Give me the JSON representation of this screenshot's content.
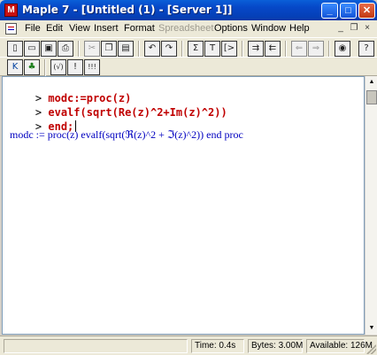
{
  "window": {
    "app_icon": "maple-leaf-icon",
    "title": "Maple 7 - [Untitled (1) - [Server 1]]",
    "buttons": {
      "minimize": "_",
      "maximize": "□",
      "close": "✕"
    }
  },
  "menubar": {
    "items": [
      "File",
      "Edit",
      "View",
      "Insert",
      "Format",
      "Spreadsheet",
      "Options",
      "Window",
      "Help"
    ],
    "disabled": [
      "Spreadsheet"
    ],
    "mdi_buttons": {
      "minimize": "_",
      "restore": "❐",
      "close": "×"
    }
  },
  "toolbar1": {
    "icons": [
      "new-icon",
      "open-icon",
      "save-icon",
      "print-icon",
      "cut-icon",
      "copy-icon",
      "paste-icon",
      "undo-icon",
      "redo-icon",
      "sigma-icon",
      "text-icon",
      "math-input-icon",
      "indent-icon",
      "outdent-icon",
      "back-icon",
      "forward-icon",
      "stop-icon"
    ],
    "glyphs": {
      "sigma": "Σ",
      "text": "T",
      "math": "[>"
    }
  },
  "toolbar2": {
    "icons": [
      "k-icon",
      "maple-leaf-icon",
      "sqrt-icon",
      "exclaim-icon",
      "triple-exclaim-icon"
    ],
    "glyphs": {
      "k": "K",
      "sqrt": "(√)",
      "exclaim": "!",
      "triple": "!!!"
    }
  },
  "worksheet": {
    "prompt": ">",
    "lines": [
      "modc:=proc(z)",
      "evalf(sqrt(Re(z)^2+Im(z)^2))",
      "end;"
    ],
    "output": "modc := proc(z) evalf(sqrt(ℜ(z)^2 + ℑ(z)^2)) end proc"
  },
  "statusbar": {
    "time": "Time:  0.4s",
    "bytes": "Bytes: 3.00M",
    "available": "Available: 126M"
  }
}
